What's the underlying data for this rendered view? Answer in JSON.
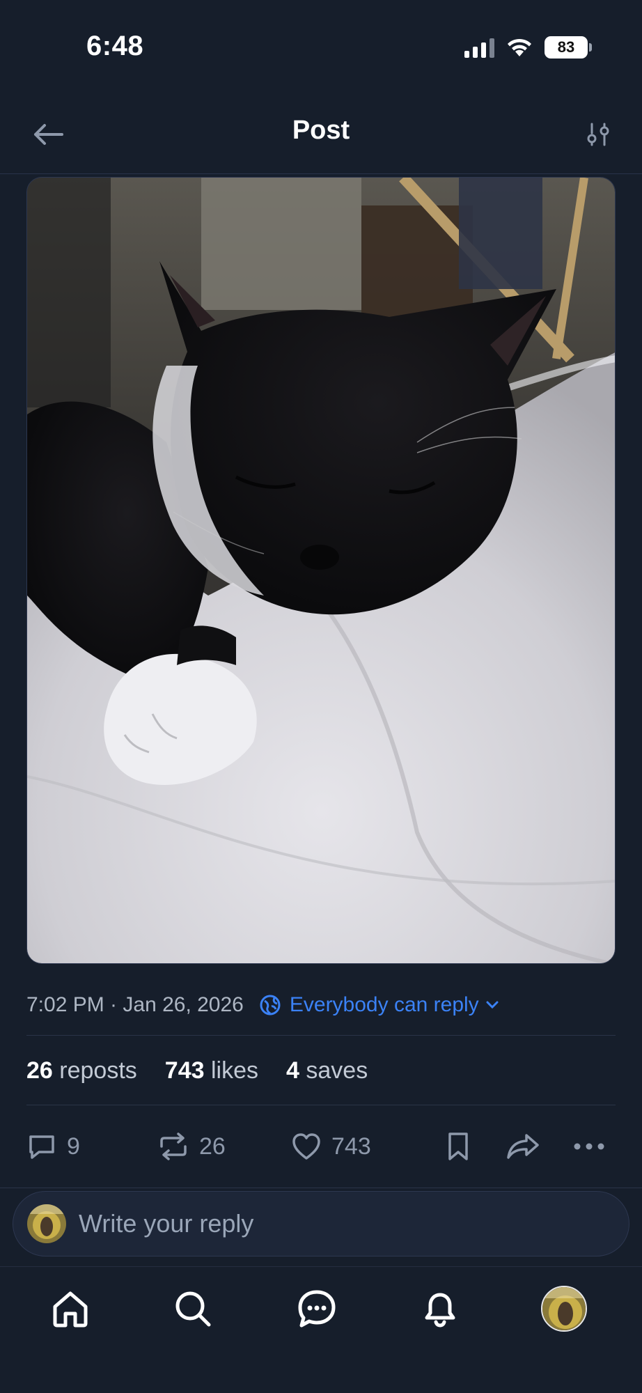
{
  "status_bar": {
    "time": "6:48",
    "battery": "83"
  },
  "header": {
    "title": "Post",
    "back_icon": "arrow-left-icon",
    "filter_icon": "sliders-icon"
  },
  "post": {
    "image_description_icon": "cat-photo",
    "timestamp": "7:02 PM · Jan 26, 2026",
    "reply_setting": "Everybody can reply",
    "stats": [
      {
        "count": "26",
        "label": "reposts"
      },
      {
        "count": "743",
        "label": "likes"
      },
      {
        "count": "4",
        "label": "saves"
      }
    ],
    "actions": {
      "replies": "9",
      "reposts": "26",
      "likes": "743"
    }
  },
  "reply_box": {
    "placeholder": "Write your reply"
  },
  "colors": {
    "background": "#161e2b",
    "accent": "#3b82f6",
    "muted": "#8e99ab"
  }
}
